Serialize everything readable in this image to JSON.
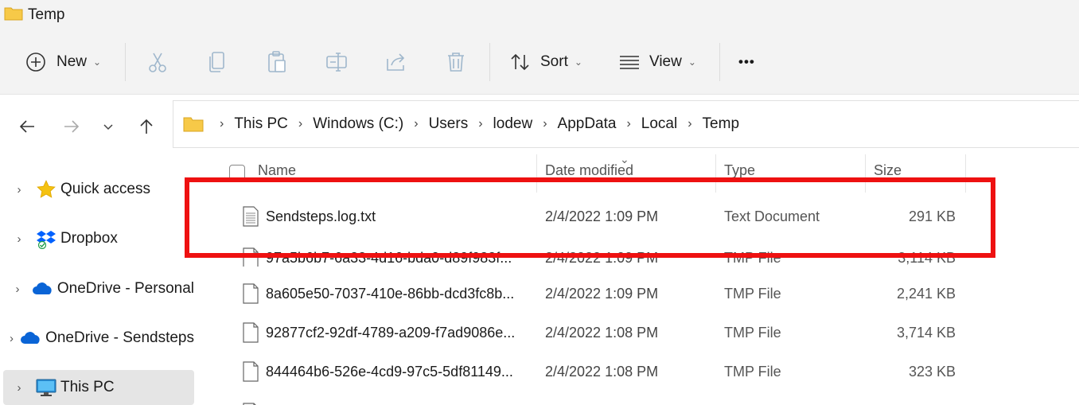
{
  "window": {
    "title": "Temp"
  },
  "toolbar": {
    "new_label": "New",
    "sort_label": "Sort",
    "view_label": "View",
    "more_label": "•••"
  },
  "address": {
    "crumbs": [
      "This PC",
      "Windows (C:)",
      "Users",
      "lodew",
      "AppData",
      "Local",
      "Temp"
    ]
  },
  "sidebar": {
    "items": [
      {
        "label": "Quick access"
      },
      {
        "label": "Dropbox"
      },
      {
        "label": "OneDrive - Personal"
      },
      {
        "label": "OneDrive - Sendsteps"
      },
      {
        "label": "This PC"
      }
    ]
  },
  "columns": {
    "name": "Name",
    "date": "Date modified",
    "type": "Type",
    "size": "Size"
  },
  "files": [
    {
      "name": "Sendsteps.log.txt",
      "date": "2/4/2022 1:09 PM",
      "type": "Text Document",
      "size": "291 KB"
    },
    {
      "name": "97a5b6b7-6a33-4d16-bda0-d89f983f...",
      "date": "2/4/2022 1:09 PM",
      "type": "TMP File",
      "size": "3,114 KB"
    },
    {
      "name": "8a605e50-7037-410e-86bb-dcd3fc8b...",
      "date": "2/4/2022 1:09 PM",
      "type": "TMP File",
      "size": "2,241 KB"
    },
    {
      "name": "92877cf2-92df-4789-a209-f7ad9086e...",
      "date": "2/4/2022 1:08 PM",
      "type": "TMP File",
      "size": "3,714 KB"
    },
    {
      "name": "844464b6-526e-4cd9-97c5-5df81149...",
      "date": "2/4/2022 1:08 PM",
      "type": "TMP File",
      "size": "323 KB"
    }
  ],
  "colors": {
    "highlight": "#ee1111",
    "folder": "#f7c948",
    "selected_bg": "#e5e5e5"
  }
}
